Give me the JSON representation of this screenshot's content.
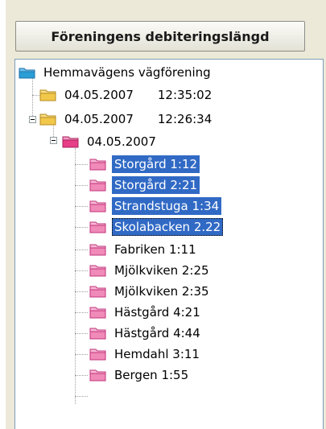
{
  "header": {
    "title": "Föreningens debiteringslängd"
  },
  "tree": {
    "root": {
      "label": "Hemmavägens vägförening"
    },
    "batch1": {
      "date": "04.05.2007",
      "time": "12:35:02"
    },
    "batch2": {
      "date": "04.05.2007",
      "time": "12:26:34"
    },
    "sub": {
      "label": "04.05.2007"
    },
    "items": [
      {
        "label": "Storgård 1:12",
        "selected": true
      },
      {
        "label": "Storgård 2:21",
        "selected": true
      },
      {
        "label": "Strandstuga 1:34",
        "selected": true
      },
      {
        "label": "Skolabacken 2.22",
        "selected": true
      },
      {
        "label": "Fabriken 1:11",
        "selected": false
      },
      {
        "label": "Mjölkviken 2:25",
        "selected": false
      },
      {
        "label": "Mjölkviken 2:35",
        "selected": false
      },
      {
        "label": "Hästgård 4:21",
        "selected": false
      },
      {
        "label": "Hästgård 4:44",
        "selected": false
      },
      {
        "label": "Hemdahl 3:11",
        "selected": false
      },
      {
        "label": "Bergen 1:55",
        "selected": false
      }
    ]
  },
  "colors": {
    "root_folder": "#2a9fd6",
    "yellow_folder": "#f2c84b",
    "pink_folder": "#e63e87",
    "selection": "#316ac5"
  }
}
